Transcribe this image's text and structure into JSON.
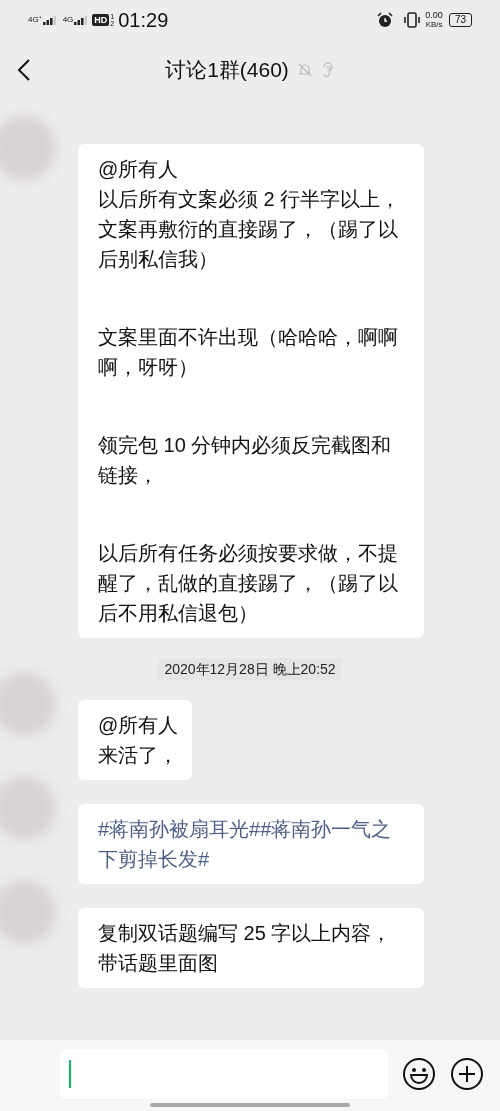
{
  "status_bar": {
    "networks": [
      {
        "label": "4G⁺"
      },
      {
        "label": "4G"
      }
    ],
    "hd": {
      "label": "HD",
      "slots": [
        "1",
        "2"
      ]
    },
    "time": "01:29",
    "speed": {
      "value": "0.00",
      "unit": "KB/s"
    },
    "battery": "73"
  },
  "header": {
    "title": "讨论1群(460)"
  },
  "messages": [
    {
      "kind": "text",
      "mention": "@所有人",
      "paragraphs": [
        {
          "lines": [
            "以后所有文案必须 2 行半字以上，",
            "文案再敷衍的直接踢了，（踢了以后别私信我）"
          ]
        },
        {
          "lines": [
            "文案里面不许出现（哈哈哈，啊啊啊，呀呀）"
          ]
        },
        {
          "lines": [
            "领完包 10 分钟内必须反完截图和链接，"
          ]
        },
        {
          "lines": [
            "以后所有任务必须按要求做，不提醒了，乱做的直接踢了，（踢了以后不用私信退包）"
          ]
        }
      ]
    },
    {
      "kind": "time",
      "text": "2020年12月28日 晚上20:52"
    },
    {
      "kind": "text",
      "mention": "@所有人",
      "text": "来活了，"
    },
    {
      "kind": "topic",
      "text": "#蒋南孙被扇耳光##蒋南孙一气之下剪掉长发#"
    },
    {
      "kind": "text",
      "text": "复制双话题编写 25 字以上内容，带话题里面图"
    }
  ]
}
